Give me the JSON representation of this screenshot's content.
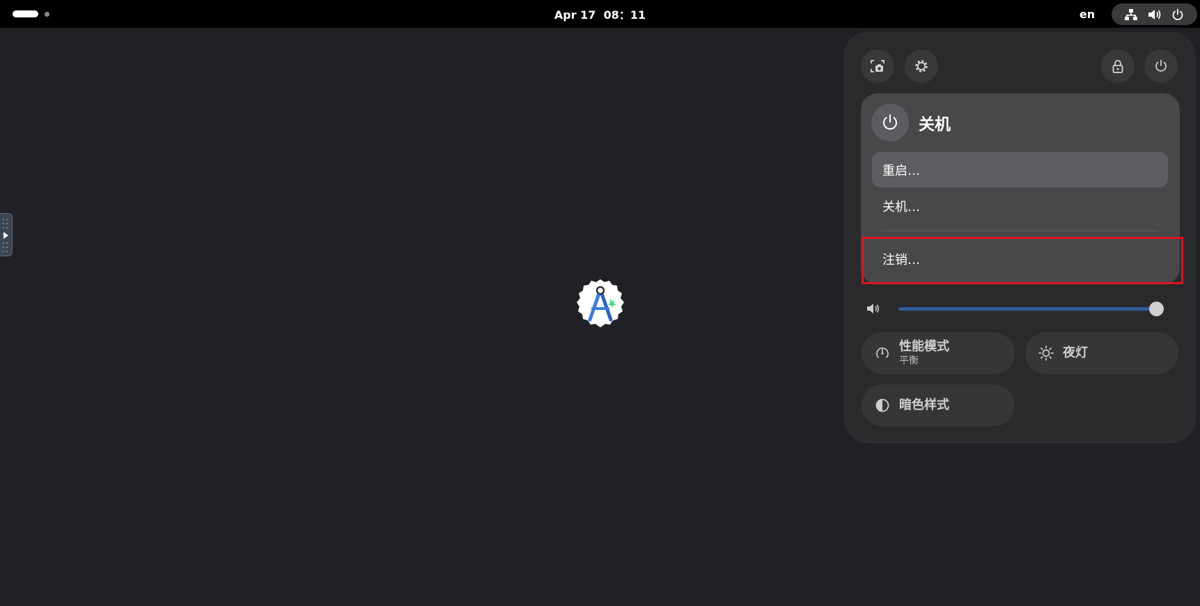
{
  "topbar": {
    "clock": "Apr 17  08：11",
    "keyboard_layout": "en",
    "tray_icons": [
      "network-wired-icon",
      "speaker-volume-icon",
      "power-icon"
    ]
  },
  "quick_settings": {
    "top_buttons": [
      "screenshot-icon",
      "settings-gear-icon",
      "lock-icon",
      "power-icon"
    ],
    "power_menu": {
      "title": "关机",
      "items": [
        {
          "label": "重启…",
          "hovered": true
        },
        {
          "label": "关机…",
          "hovered": false
        },
        {
          "label": "注销…",
          "hovered": false,
          "highlighted": true
        }
      ]
    },
    "volume": {
      "level": 0.97
    },
    "toggles": [
      {
        "title": "性能模式",
        "subtitle": "平衡",
        "icon": "power-profile-icon"
      },
      {
        "title": "夜灯",
        "icon": "night-light-sun-icon"
      },
      {
        "title": "暗色样式",
        "icon": "dark-style-icon"
      }
    ]
  },
  "colors": {
    "accent": "#2f5d99",
    "highlight_box": "#e0141b",
    "panel": "#2a2a2d",
    "menu": "#48484b"
  }
}
